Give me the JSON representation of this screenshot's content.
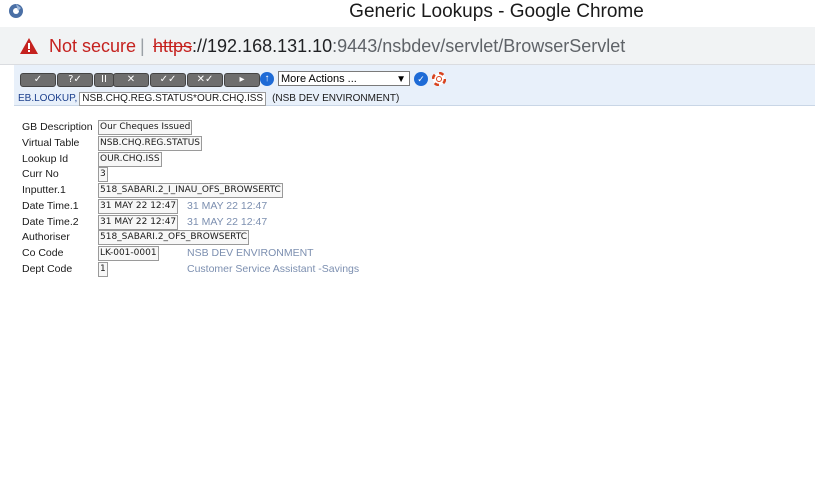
{
  "window": {
    "title": "Generic Lookups - Google Chrome"
  },
  "address": {
    "not_secure": "Not secure",
    "separator": "|",
    "scheme": "https",
    "host": "://192.168.131.10",
    "rest": ":9443/nsbdev/servlet/BrowserServlet"
  },
  "toolbar": {
    "buttons": [
      "✓",
      "?✓",
      "II",
      "✕",
      "✓✓",
      "✕✓",
      "▸"
    ],
    "info_icon": "info-icon",
    "actions_select": "More Actions ...",
    "go_icon": "go-icon",
    "help_icon": "help-icon"
  },
  "application": {
    "label": "EB.LOOKUP,",
    "record_id": "NSB.CHQ.REG.STATUS*OUR.CHQ.ISS",
    "environment": "(NSB DEV ENVIRONMENT)"
  },
  "fields": [
    {
      "label": "GB Description",
      "value": "Our Cheques Issued",
      "enrichment": ""
    },
    {
      "label": "Virtual Table",
      "value": "NSB.CHQ.REG.STATUS",
      "enrichment": ""
    },
    {
      "label": "Lookup Id",
      "value": "OUR.CHQ.ISS",
      "enrichment": ""
    },
    {
      "label": "Curr No",
      "value": "3",
      "enrichment": ""
    },
    {
      "label": "Inputter.1",
      "value": "518_SABARI.2_I_INAU_OFS_BROWSERTC",
      "enrichment": ""
    },
    {
      "label": "Date Time.1",
      "value": "31 MAY 22 12:47",
      "enrichment": "31 MAY 22 12:47"
    },
    {
      "label": "Date Time.2",
      "value": "31 MAY 22 12:47",
      "enrichment": "31 MAY 22 12:47"
    },
    {
      "label": "Authoriser",
      "value": "518_SABARI.2_OFS_BROWSERTC",
      "enrichment": ""
    },
    {
      "label": "Co Code",
      "value": "LK-001-0001",
      "enrichment": "NSB DEV ENVIRONMENT"
    },
    {
      "label": "Dept Code",
      "value": "1",
      "enrichment": "Customer Service Assistant -Savings"
    }
  ],
  "colors": {
    "warning": "#c5221f",
    "enrichment": "#7c8fb0",
    "toolbar_bg": "#e8f0fa"
  }
}
